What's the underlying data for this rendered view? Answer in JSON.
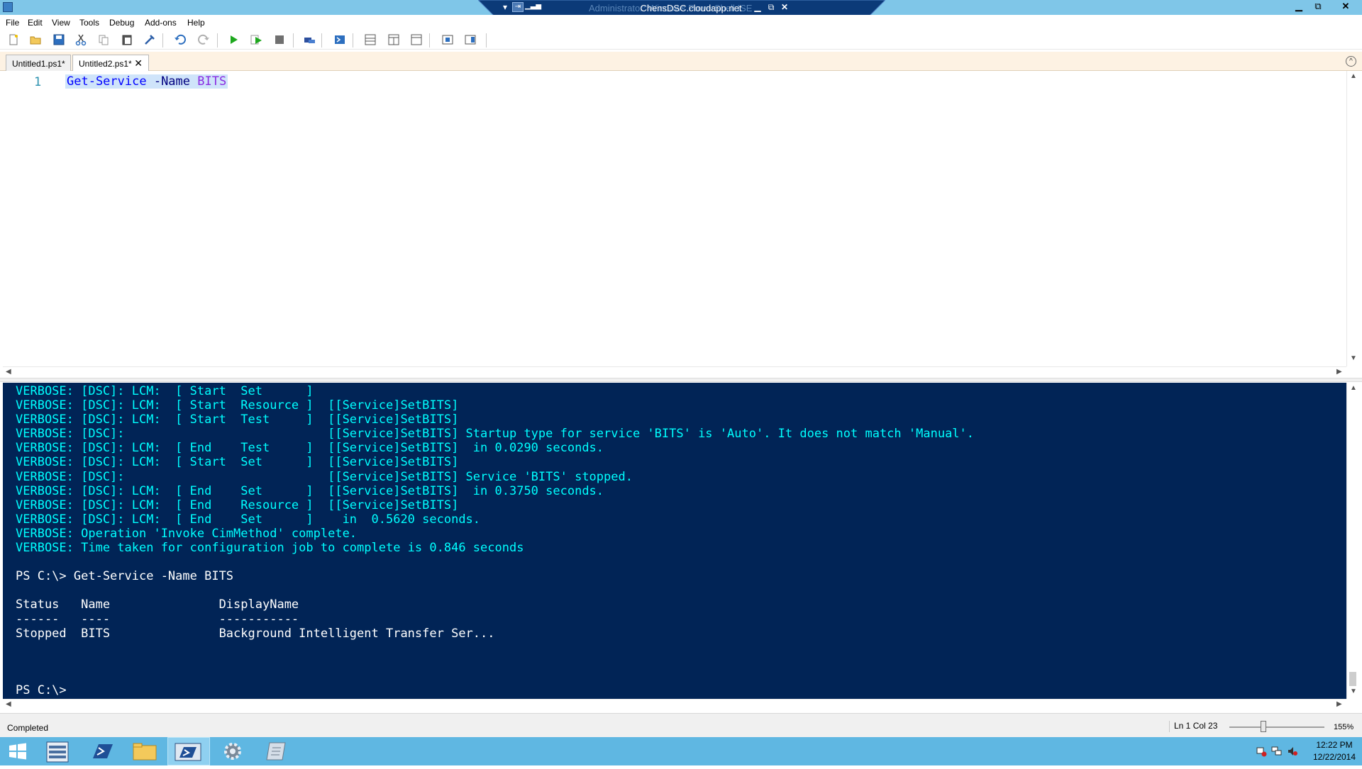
{
  "titlebar": {
    "remote_title": "ChensDSC.cloudapp.net",
    "ghost_title": "Administrator: Windows PowerShell ISE"
  },
  "menu": [
    "File",
    "Edit",
    "View",
    "Tools",
    "Debug",
    "Add-ons",
    "Help"
  ],
  "toolbar_icons": [
    "new-file-icon",
    "open-icon",
    "save-icon",
    "cut-icon",
    "copy-icon",
    "paste-icon",
    "clear-icon",
    "undo-icon",
    "redo-icon",
    "run-icon",
    "run-selection-icon",
    "stop-icon",
    "remote-tab-icon",
    "powershell-icon",
    "layout-top-icon",
    "layout-right-icon",
    "layout-max-icon",
    "show-command-icon",
    "show-addon-icon"
  ],
  "tabs": [
    {
      "label": "Untitled1.ps1*"
    },
    {
      "label": "Untitled2.ps1*",
      "close": "✕"
    }
  ],
  "editor": {
    "line_number": "1",
    "code": {
      "cmd": "Get-Service",
      "param": " -Name",
      "arg": " BITS"
    }
  },
  "console": {
    "lines": [
      {
        "text": "VERBOSE: [DSC]: LCM:  [ Start  Set      ]",
        "color": "cyan"
      },
      {
        "text": "VERBOSE: [DSC]: LCM:  [ Start  Resource ]  [[Service]SetBITS]",
        "color": "cyan"
      },
      {
        "text": "VERBOSE: [DSC]: LCM:  [ Start  Test     ]  [[Service]SetBITS]",
        "color": "cyan"
      },
      {
        "text": "VERBOSE: [DSC]:                            [[Service]SetBITS] Startup type for service 'BITS' is 'Auto'. It does not match 'Manual'.",
        "color": "cyan"
      },
      {
        "text": "VERBOSE: [DSC]: LCM:  [ End    Test     ]  [[Service]SetBITS]  in 0.0290 seconds.",
        "color": "cyan"
      },
      {
        "text": "VERBOSE: [DSC]: LCM:  [ Start  Set      ]  [[Service]SetBITS]",
        "color": "cyan"
      },
      {
        "text": "VERBOSE: [DSC]:                            [[Service]SetBITS] Service 'BITS' stopped.",
        "color": "cyan"
      },
      {
        "text": "VERBOSE: [DSC]: LCM:  [ End    Set      ]  [[Service]SetBITS]  in 0.3750 seconds.",
        "color": "cyan"
      },
      {
        "text": "VERBOSE: [DSC]: LCM:  [ End    Resource ]  [[Service]SetBITS]",
        "color": "cyan"
      },
      {
        "text": "VERBOSE: [DSC]: LCM:  [ End    Set      ]    in  0.5620 seconds.",
        "color": "cyan"
      },
      {
        "text": "VERBOSE: Operation 'Invoke CimMethod' complete.",
        "color": "cyan"
      },
      {
        "text": "VERBOSE: Time taken for configuration job to complete is 0.846 seconds",
        "color": "cyan"
      },
      {
        "text": "",
        "color": "white"
      },
      {
        "text": "PS C:\\> Get-Service -Name BITS",
        "color": "white"
      },
      {
        "text": "",
        "color": "white"
      },
      {
        "text": "Status   Name               DisplayName",
        "color": "white"
      },
      {
        "text": "------   ----               -----------",
        "color": "white"
      },
      {
        "text": "Stopped  BITS               Background Intelligent Transfer Ser...",
        "color": "white"
      },
      {
        "text": "",
        "color": "white"
      },
      {
        "text": "",
        "color": "white"
      },
      {
        "text": "",
        "color": "white"
      },
      {
        "text": "PS C:\\>",
        "color": "white"
      }
    ]
  },
  "status": {
    "text": "Completed",
    "position": "Ln 1  Col 23",
    "zoom": "155%"
  },
  "taskbar": {
    "buttons": [
      "start-button",
      "server-manager-button",
      "powershell-button",
      "file-explorer-button",
      "powershell-ise-button",
      "settings-button",
      "notepad-button"
    ],
    "active": "powershell-ise-button",
    "time": "12:22 PM",
    "date": "12/22/2014"
  },
  "colors": {
    "console_bg": "#012456",
    "console_cyan": "#00ffff",
    "taskbar": "#5fb7e2",
    "tab_strip": "#fdf2e3"
  }
}
